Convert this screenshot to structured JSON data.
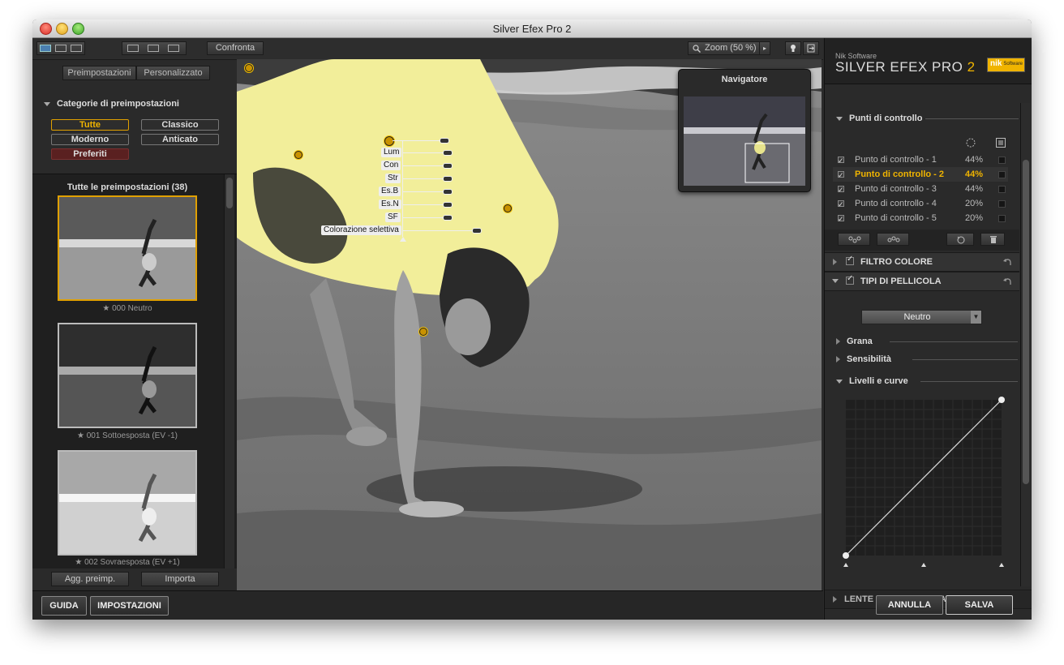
{
  "window": {
    "title": "Silver Efex Pro 2"
  },
  "toolbar": {
    "compare_label": "Confronta",
    "zoom_label": "Zoom (50 %)"
  },
  "left_panel": {
    "tabs": [
      {
        "label": "Preimpostazioni"
      },
      {
        "label": "Personalizzato"
      }
    ],
    "categories_header": "Categorie di preimpostazioni",
    "categories": [
      {
        "label": "Tutte",
        "selected": true
      },
      {
        "label": "Classico"
      },
      {
        "label": "Moderno"
      },
      {
        "label": "Anticato"
      },
      {
        "label": "Preferiti"
      }
    ],
    "presets_header": "Tutte le preimpostazioni (38)",
    "presets": [
      {
        "label": "000 Neutro",
        "selected": true
      },
      {
        "label": "001 Sottoesposta (EV -1)"
      },
      {
        "label": "002 Sovraesposta (EV +1)"
      }
    ],
    "add_preset_label": "Agg. preimp.",
    "import_label": "Importa"
  },
  "canvas": {
    "slider_labels": [
      "Lum",
      "Con",
      "Str",
      "Es.B",
      "Es.N",
      "SF"
    ],
    "selective_color_label": "Colorazione selettiva",
    "navigator_title": "Navigatore"
  },
  "right_panel": {
    "brand_small": "Nik Software",
    "brand_name": "SILVER EFEX PRO",
    "brand_version": "2",
    "logo_text": "nik",
    "logo_sub": "Software",
    "control_points_header": "Punti di controllo",
    "control_points": [
      {
        "label": "Punto di controllo - 1",
        "value": "44%"
      },
      {
        "label": "Punto di controllo - 2",
        "value": "44%",
        "selected": true
      },
      {
        "label": "Punto di controllo - 3",
        "value": "44%"
      },
      {
        "label": "Punto di controllo - 4",
        "value": "20%"
      },
      {
        "label": "Punto di controllo - 5",
        "value": "20%"
      }
    ],
    "color_filter": "FILTRO COLORE",
    "film_types": "TIPI DI PELLICOLA",
    "film_select_value": "Neutro",
    "grain": "Grana",
    "sensitivity": "Sensibilità",
    "levels_curves": "Livelli e curve",
    "lens_histogram": "LENTE E ISTOGRAMMA"
  },
  "bottom": {
    "help_label": "GUIDA",
    "settings_label": "IMPOSTAZIONI",
    "cancel_label": "ANNULLA",
    "save_label": "SALVA"
  },
  "colors": {
    "accent": "#f0b400",
    "highlight_yellow": "#f2ee9a",
    "panel": "#2a2a2a"
  }
}
